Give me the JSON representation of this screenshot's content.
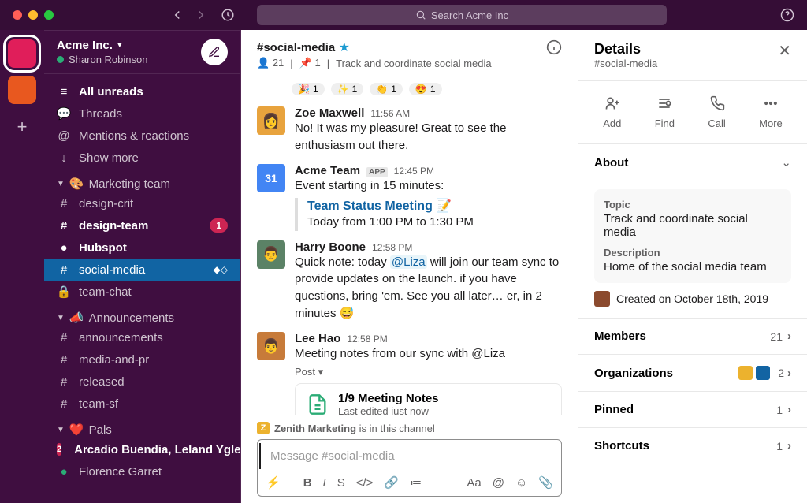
{
  "search": {
    "placeholder": "Search Acme Inc"
  },
  "workspace": {
    "name": "Acme Inc.",
    "user": "Sharon Robinson"
  },
  "nav": {
    "all_unreads": "All unreads",
    "threads": "Threads",
    "mentions": "Mentions & reactions",
    "show_more": "Show more"
  },
  "sections": {
    "marketing": {
      "label": "Marketing team",
      "emoji": "🎨"
    },
    "announcements": {
      "label": "Announcements",
      "emoji": "📣"
    },
    "pals": {
      "label": "Pals",
      "emoji": "❤️"
    }
  },
  "channels": {
    "design_crit": "design-crit",
    "design_team": "design-team",
    "hubspot": "Hubspot",
    "social_media": "social-media",
    "team_chat": "team-chat",
    "announcements": "announcements",
    "media_pr": "media-and-pr",
    "released": "released",
    "team_sf": "team-sf"
  },
  "badges": {
    "design_team": "1",
    "arcadio": "2"
  },
  "dms": {
    "arcadio": "Arcadio Buendia, Leland Ygle…",
    "florence": "Florence Garret"
  },
  "channel_header": {
    "name": "#social-media",
    "star": "★",
    "members": "21",
    "pins": "1",
    "topic": "Track and coordinate social media"
  },
  "reactions": [
    {
      "emoji": "🎉",
      "count": "1"
    },
    {
      "emoji": "✨",
      "count": "1"
    },
    {
      "emoji": "👏",
      "count": "1"
    },
    {
      "emoji": "😍",
      "count": "1"
    }
  ],
  "messages": {
    "zoe": {
      "author": "Zoe Maxwell",
      "time": "11:56 AM",
      "text": "No! It was my pleasure! Great to see the enthusiasm out there."
    },
    "acme": {
      "author": "Acme Team",
      "badge": "APP",
      "time": "12:45 PM",
      "text": "Event starting in 15 minutes:",
      "link": "Team Status Meeting",
      "link_emoji": "📝",
      "when": "Today from 1:00 PM to 1:30 PM"
    },
    "harry": {
      "author": "Harry Boone",
      "time": "12:58 PM",
      "pre": "Quick note: today ",
      "mention": "@Liza",
      "post": " will join our team sync to provide updates on the launch. if you have questions, bring 'em. See you all later… er, in 2 minutes 😅"
    },
    "lee": {
      "author": "Lee Hao",
      "time": "12:58 PM",
      "text": "Meeting notes from our sync with @Liza",
      "post_label": "Post ▾",
      "doc_title": "1/9 Meeting Notes",
      "doc_sub": "Last edited just now"
    }
  },
  "shared": {
    "org": "Zenith Marketing",
    "suffix": " is in this channel"
  },
  "composer": {
    "placeholder": "Message #social-media"
  },
  "details": {
    "title": "Details",
    "subtitle": "#social-media",
    "actions": {
      "add": "Add",
      "find": "Find",
      "call": "Call",
      "more": "More"
    },
    "about": {
      "label": "About",
      "topic_label": "Topic",
      "topic": "Track and coordinate social media",
      "desc_label": "Description",
      "desc": "Home of the social media team",
      "created": "Created on October 18th, 2019"
    },
    "rows": {
      "members": {
        "label": "Members",
        "count": "21"
      },
      "orgs": {
        "label": "Organizations",
        "count": "2"
      },
      "pinned": {
        "label": "Pinned",
        "count": "1"
      },
      "shortcuts": {
        "label": "Shortcuts",
        "count": "1"
      }
    }
  }
}
